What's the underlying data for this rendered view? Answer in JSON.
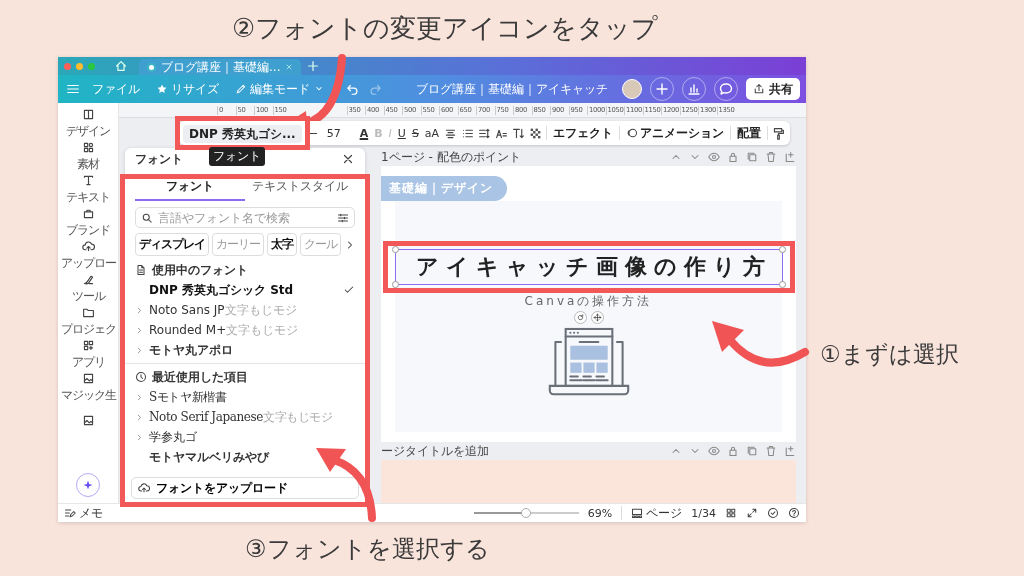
{
  "captions": {
    "top": "②フォントの変更アイコンをタップ",
    "right": "①まずは選択",
    "bottom": "③フォントを選択する"
  },
  "browser": {
    "tab_title": "ブログ講座｜基礎編..."
  },
  "menu_bar": {
    "items": [
      "ファイル",
      "リサイズ",
      "編集モード"
    ],
    "redo_disabled": true,
    "document_title": "ブログ講座｜基礎編｜アイキャッチ",
    "share": "共有"
  },
  "rail": [
    "デザイン",
    "素材",
    "テキスト",
    "ブランド",
    "アップロー",
    "ツール",
    "プロジェク",
    "アプリ",
    "マジック生"
  ],
  "ruler": [
    "0",
    "50",
    "100",
    "150",
    "350",
    "400",
    "450",
    "500",
    "550",
    "600",
    "650",
    "700",
    "750",
    "800",
    "850",
    "900",
    "950",
    "1000",
    "1050",
    "1100",
    "1150",
    "1200",
    "1250",
    "1300",
    "1350"
  ],
  "toolbar": {
    "font": "DNP 秀英丸ゴシ...",
    "size": "57",
    "tooltip": "フォント",
    "format": [
      {
        "glyph": "A",
        "kind": "color",
        "disabled": false
      },
      {
        "glyph": "B",
        "kind": "bold",
        "disabled": true
      },
      {
        "glyph": "I",
        "kind": "italic",
        "disabled": true
      },
      {
        "glyph": "U",
        "kind": "underline",
        "disabled": false
      },
      {
        "glyph": "S",
        "kind": "strike",
        "disabled": false
      },
      {
        "glyph": "aA",
        "kind": "case",
        "disabled": false
      }
    ],
    "effects": "エフェクト",
    "animation": "アニメーション",
    "position": "配置"
  },
  "font_panel": {
    "title": "フォント",
    "tabs": [
      {
        "label": "フォント",
        "selected": true
      },
      {
        "label": "テキストスタイル",
        "selected": false
      }
    ],
    "search": {
      "placeholder": "言語やフォント名で検索"
    },
    "chips": [
      {
        "label": "ディスプレイ",
        "kind": "bold"
      },
      {
        "label": "カーリー",
        "kind": "light"
      },
      {
        "label": "太字",
        "kind": "bold"
      },
      {
        "label": "クール",
        "kind": "light"
      }
    ],
    "sections": [
      {
        "title": "使用中のフォント",
        "fonts": [
          {
            "name": "DNP 秀英丸ゴシック Std",
            "kind": "regular",
            "expandable": false,
            "selected": true
          },
          {
            "name": "Noto Sans JP",
            "sample": "文字もじモジ",
            "kind": "regular",
            "expandable": true,
            "selected": false
          },
          {
            "name": "Rounded M+",
            "sample": "文字もじモジ",
            "kind": "regular",
            "expandable": true,
            "selected": false
          },
          {
            "name": "モトヤ丸アポロ",
            "kind": "bold",
            "expandable": true,
            "selected": false
          }
        ]
      },
      {
        "title": "最近使用した項目",
        "fonts": [
          {
            "name": "Sモトヤ新楷書",
            "kind": "serif",
            "expandable": true,
            "selected": false
          },
          {
            "name": "Noto Serif Japanese",
            "sample": "文字もじモジ",
            "kind": "serif",
            "expandable": true,
            "selected": false
          },
          {
            "name": "学参丸ゴ",
            "kind": "regular",
            "expandable": true,
            "selected": false
          },
          {
            "name": "モトヤマルベリみやび",
            "kind": "bold",
            "expandable": false,
            "selected": false
          }
        ]
      }
    ],
    "upload": "フォントをアップロード"
  },
  "canvas": {
    "page_header": "1ページ - 配色のポイント",
    "badge": "基礎編｜デザイン",
    "title": "アイキャッチ画像の作り方",
    "title_selected": true,
    "subtitle": "Canvaの操作方法",
    "next_page_header": "ージタイトルを追加"
  },
  "status_bar": {
    "notes": "メモ",
    "zoom": {
      "level": 0.5
    },
    "zoom_reading": "69%",
    "pages": "ページ",
    "page_count": "1/34"
  }
}
